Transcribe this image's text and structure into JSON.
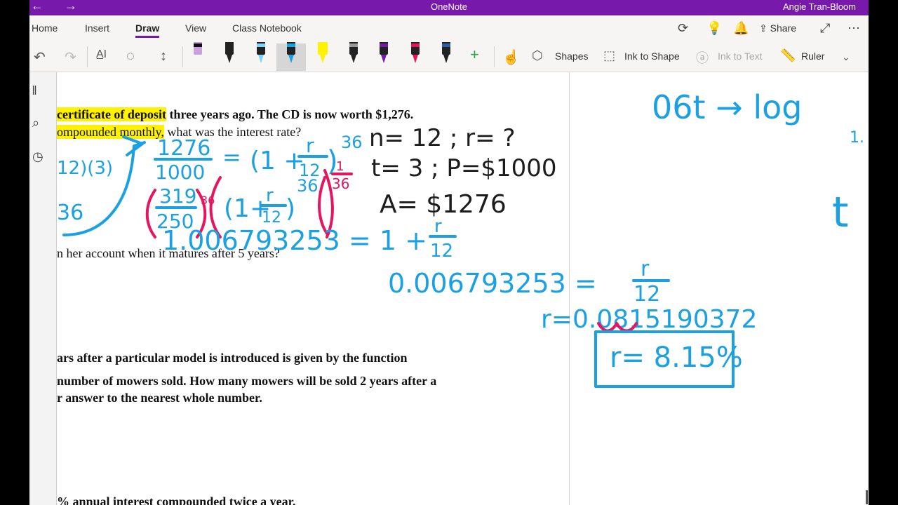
{
  "titlebar": {
    "app_title": "OneNote",
    "user": "Angie Tran-Bloom",
    "back": "←",
    "forward": "→"
  },
  "menu": {
    "tabs": [
      "Home",
      "Insert",
      "Draw",
      "View",
      "Class Notebook"
    ],
    "share": "Share"
  },
  "ribbon": {
    "shapes": "Shapes",
    "ink_to_shape": "Ink to Shape",
    "ink_to_text": "Ink to Text",
    "ruler": "Ruler"
  },
  "colors": {
    "accent": "#7719aa",
    "ink_blue": "#1ba1e2",
    "ink_pink": "#e5155f",
    "highlight": "#fff200"
  },
  "typed": {
    "l1_hl": "certificate of deposit",
    "l1_rest": " three years ago. The CD is now worth $1,276.",
    "l2_hl": "ompounded monthly,",
    "l2_rest": " what was the interest rate?",
    "l3": "n her account when it matures after 5 years?",
    "l4": "ars after a particular model is introduced is given by the function",
    "l5": " number of mowers sold. How many mowers will be sold 2 years after a",
    "l6": "r answer to the nearest whole number.",
    "l7": "% annual interest compounded twice a year."
  },
  "ink": {
    "a1_num": "1276",
    "a1_den": "1000",
    "eq": "=",
    "one_plus": "(1 +",
    "r": "r",
    "twelve": "12",
    "exp36": "36",
    "close": ")",
    "inv_num": "1",
    "inv_den": "36",
    "b1_num": "319",
    "b1_den": "250",
    "b_one_plus": "(1+",
    "b_exp": "36",
    "left_expr": "12)(3)",
    "left_36": "36",
    "line3": "1.006793253 = 1 +",
    "line4": "0.006793253 =",
    "r_line": "r=0.0815190372",
    "r_box": "r= 8.15%",
    "given1": "n= 12 ; r= ?",
    "given2": "t= 3 ; P=$1000",
    "given3": "A= $1276",
    "right_top": "06t → log",
    "right_sub": "1.",
    "right_t": "t"
  }
}
